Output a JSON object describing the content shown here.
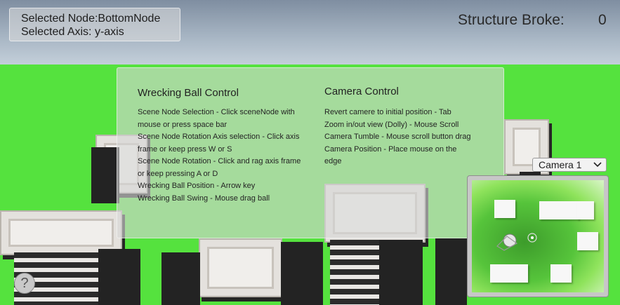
{
  "selection": {
    "node_line": "Selected Node:BottomNode",
    "axis_line": "Selected Axis: y-axis"
  },
  "status": {
    "structure_broke_label": "Structure Broke:",
    "structure_broke_value": "0"
  },
  "help": {
    "wrecking": {
      "title": "Wrecking Ball Control",
      "lines": [
        "Scene Node Selection - Click sceneNode with",
        "mouse or press space bar",
        "Scene Node Rotation Axis selection - Click axis",
        "frame or keep press  W or S",
        "Scene Node Rotation - Click and rag axis frame",
        "or keep pressing A or D",
        "Wrecking Ball Position - Arrow key",
        "Wrecking Ball Swing - Mouse drag ball"
      ]
    },
    "camera": {
      "title": "Camera Control",
      "lines": [
        "Revert camere to initial position - Tab",
        "Zoom in/out view (Dolly) - Mouse Scroll",
        "Camera Tumble - Mouse scroll button drag",
        "Camera Position - Place mouse on the",
        "edge"
      ]
    }
  },
  "camera_select": {
    "value": "Camera 1",
    "chevron_icon": "chevron-down-icon"
  },
  "help_button": {
    "label": "?"
  }
}
